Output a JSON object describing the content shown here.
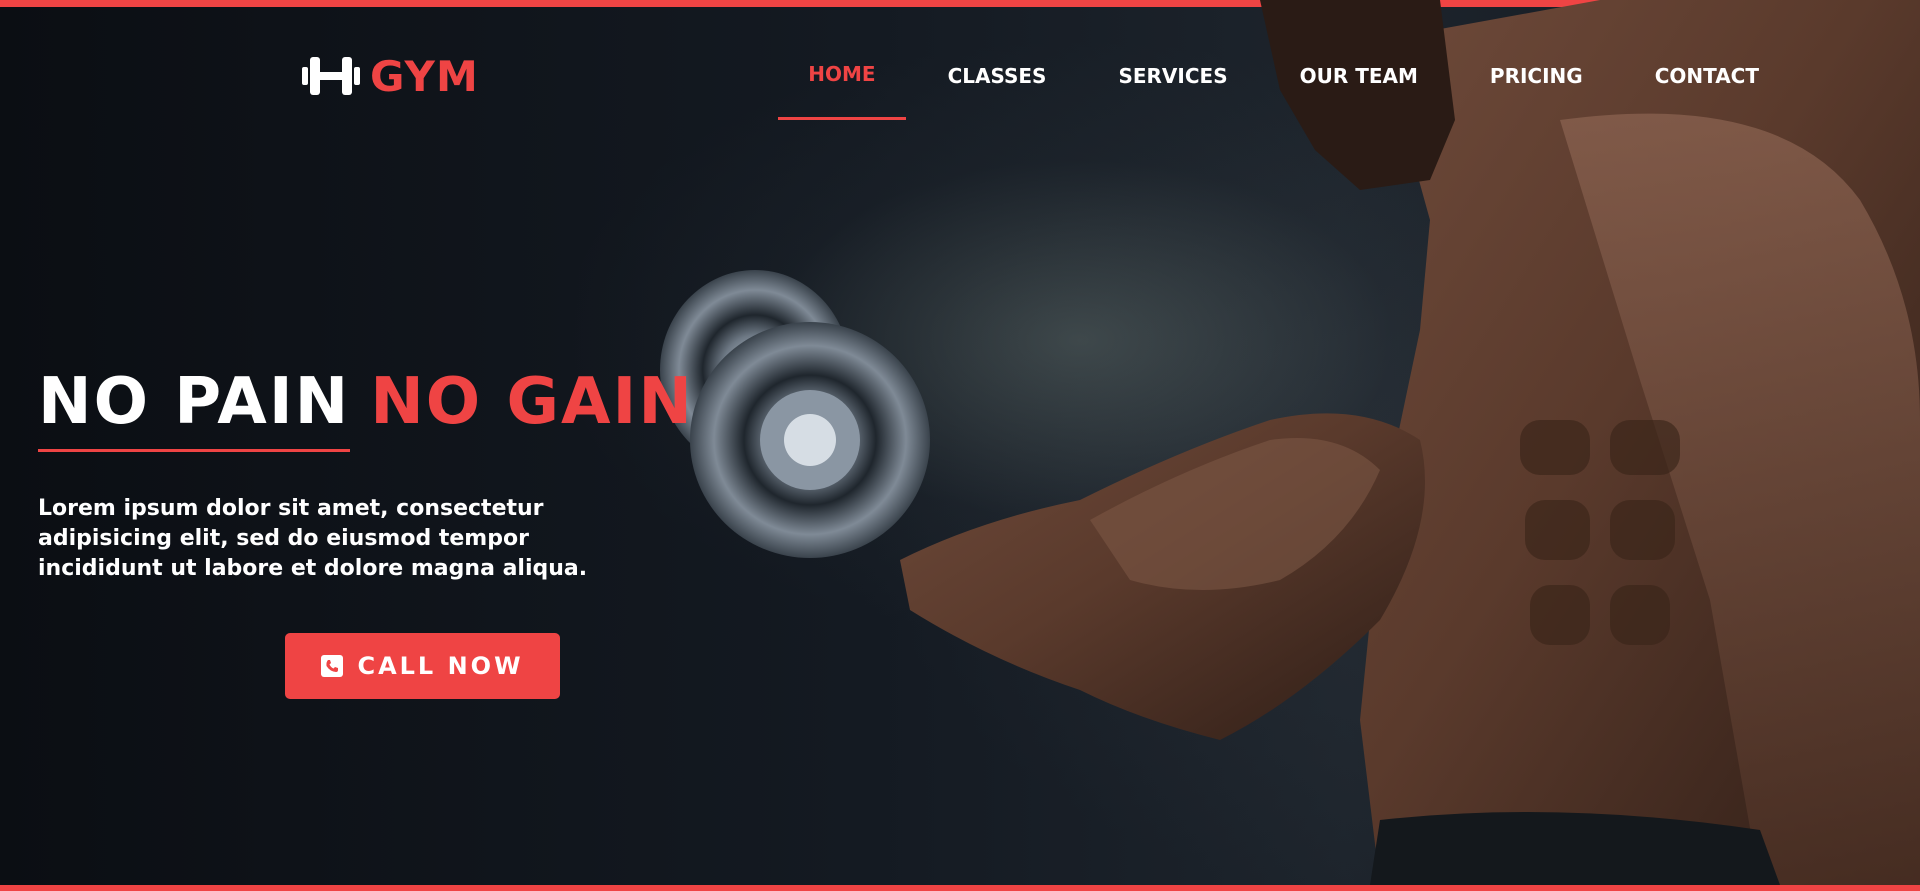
{
  "colors": {
    "accent": "#ef4444",
    "text": "#ffffff",
    "background": "#0d1015"
  },
  "logo": {
    "icon": "dumbbell-icon",
    "text": "GYM"
  },
  "nav": {
    "items": [
      {
        "label": "HOME",
        "active": true
      },
      {
        "label": "CLASSES",
        "active": false
      },
      {
        "label": "SERVICES",
        "active": false
      },
      {
        "label": "OUR TEAM",
        "active": false
      },
      {
        "label": "PRICING",
        "active": false
      },
      {
        "label": "CONTACT",
        "active": false
      }
    ]
  },
  "hero": {
    "headline_part1": "NO PAIN",
    "headline_part2": "NO GAIN",
    "description": "Lorem ipsum dolor sit amet, consectetur adipisicing elit, sed do eiusmod tempor incididunt ut labore et dolore magna aliqua.",
    "cta_label": "CALL NOW",
    "cta_icon": "phone-icon"
  },
  "image": {
    "subject": "bodybuilder-with-dumbbell"
  }
}
